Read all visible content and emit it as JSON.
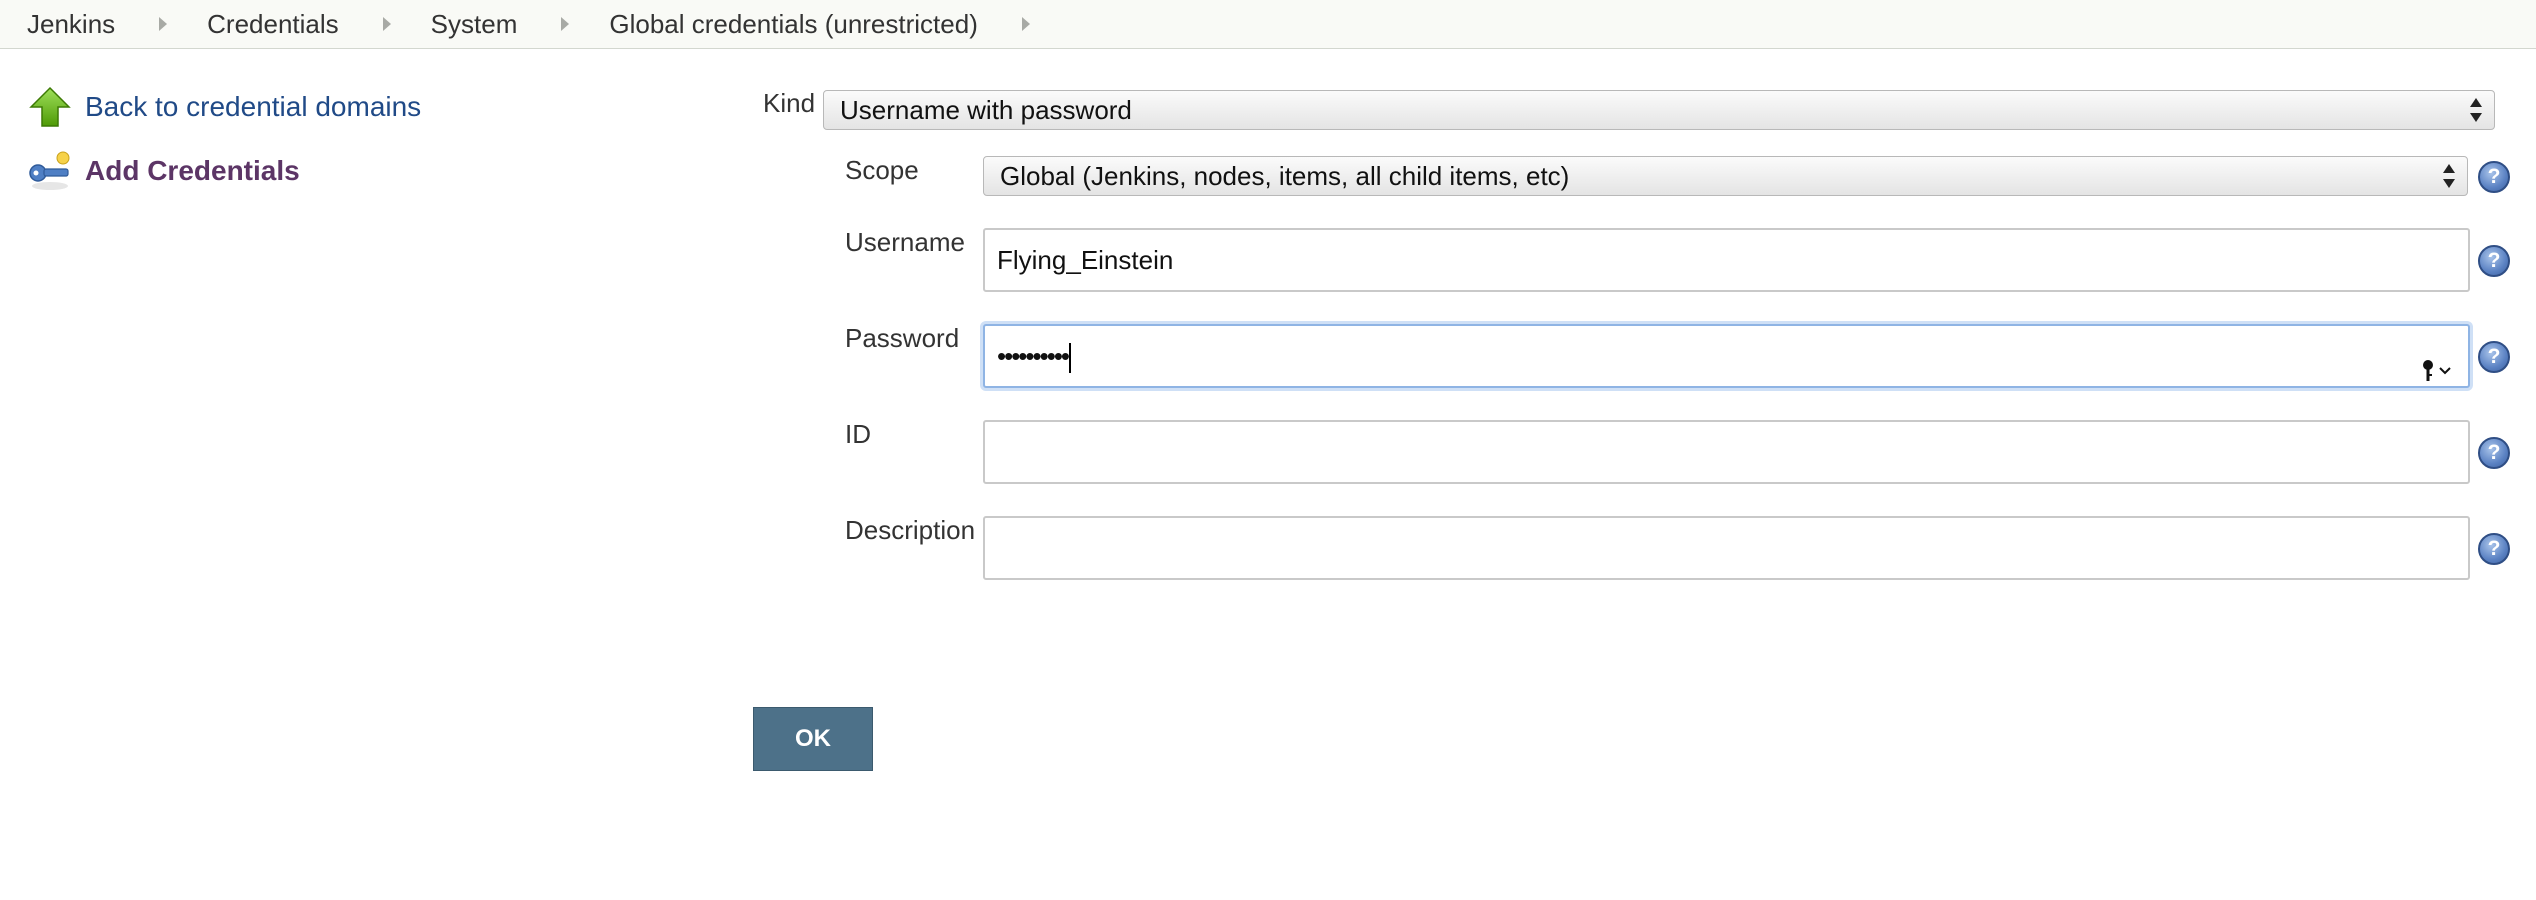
{
  "breadcrumbs": [
    {
      "label": "Jenkins"
    },
    {
      "label": "Credentials"
    },
    {
      "label": "System"
    },
    {
      "label": "Global credentials (unrestricted)"
    }
  ],
  "sidebar": {
    "back_label": "Back to credential domains",
    "add_label": "Add Credentials"
  },
  "form": {
    "kind": {
      "label": "Kind",
      "value": "Username with password"
    },
    "scope": {
      "label": "Scope",
      "value": "Global (Jenkins, nodes, items, all child items, etc)"
    },
    "username": {
      "label": "Username",
      "value": "Flying_Einstein"
    },
    "password": {
      "label": "Password",
      "masked_value": "••••••••••"
    },
    "id": {
      "label": "ID",
      "value": ""
    },
    "description": {
      "label": "Description",
      "value": ""
    },
    "help_glyph": "?",
    "ok_label": "OK"
  },
  "colors": {
    "link": "#204a87",
    "current": "#5c3566",
    "ok_button": "#4d7189",
    "help_icon": "#5b82c3"
  }
}
